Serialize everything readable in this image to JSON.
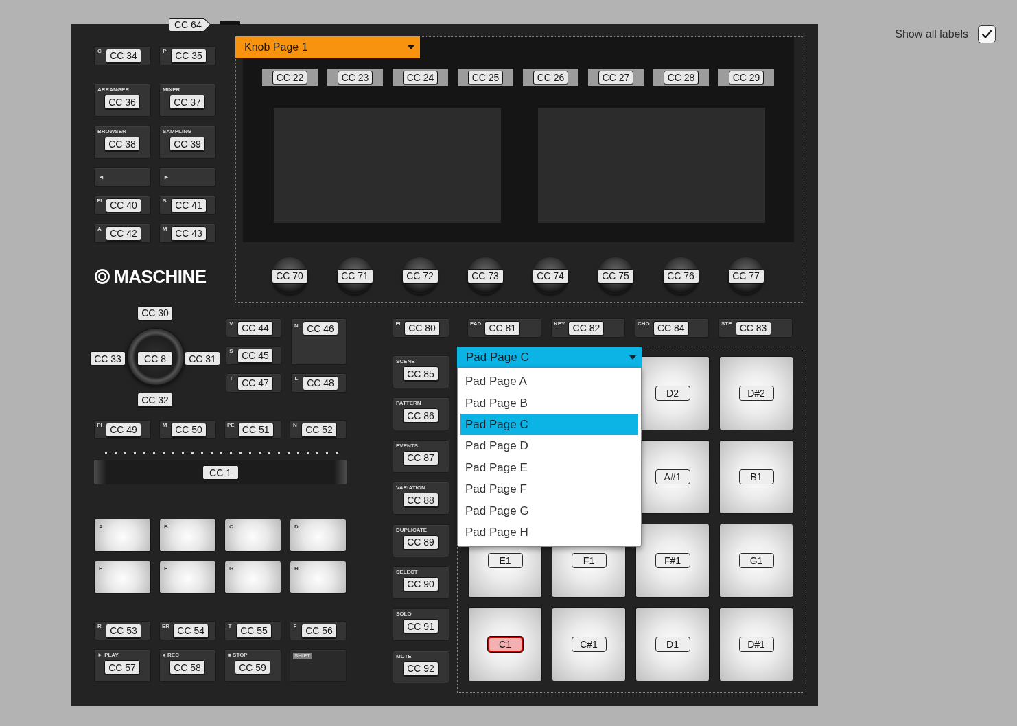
{
  "options": {
    "label": "Show all labels",
    "checked": true
  },
  "pedal": {
    "cc": "CC 64"
  },
  "view_buttons": [
    [
      {
        "kind": "short",
        "caption": "C",
        "cc": "CC 34"
      },
      {
        "kind": "short",
        "caption": "P",
        "cc": "CC 35"
      }
    ],
    [
      {
        "kind": "tall",
        "caption": "ARRANGER",
        "cc": "CC 36"
      },
      {
        "kind": "tall",
        "caption": "MIXER",
        "cc": "CC 37"
      }
    ],
    [
      {
        "kind": "tall",
        "caption": "BROWSER",
        "cc": "CC 38"
      },
      {
        "kind": "tall",
        "caption": "SAMPLING",
        "cc": "CC 39"
      }
    ],
    [
      {
        "kind": "short",
        "caption": "◄"
      },
      {
        "kind": "short",
        "caption": "►"
      }
    ],
    [
      {
        "kind": "short",
        "caption": "FI",
        "cc": "CC 40"
      },
      {
        "kind": "short",
        "caption": "S",
        "cc": "CC 41"
      }
    ],
    [
      {
        "kind": "short",
        "caption": "A",
        "cc": "CC 42"
      },
      {
        "kind": "short",
        "caption": "M",
        "cc": "CC 43"
      }
    ]
  ],
  "logo": {
    "text": "MASCHINE"
  },
  "knob_section": {
    "page_menu": {
      "value": "Knob Page 1"
    },
    "buttons": [
      "CC 22",
      "CC 23",
      "CC 24",
      "CC 25",
      "CC 26",
      "CC 27",
      "CC 28",
      "CC 29"
    ],
    "knobs": [
      "CC 70",
      "CC 71",
      "CC 72",
      "CC 73",
      "CC 74",
      "CC 75",
      "CC 76",
      "CC 77"
    ]
  },
  "encoder": {
    "top": "CC 30",
    "left": "CC 33",
    "center": "CC 8",
    "right": "CC 31",
    "bottom": "CC 32"
  },
  "encoder_buttons": [
    {
      "kind": "short",
      "caption": "V",
      "cc": "CC 44"
    },
    {
      "kind": "large",
      "caption": "N",
      "cc": "CC 46"
    },
    {
      "kind": "short",
      "caption": "S",
      "cc": "CC 45"
    },
    {
      "kind": "short",
      "caption": "T",
      "cc": "CC 47"
    },
    {
      "kind": "short",
      "caption": "L",
      "cc": "CC 48"
    }
  ],
  "performance_buttons": [
    {
      "kind": "short",
      "caption": "PI",
      "cc": "CC 49"
    },
    {
      "kind": "short",
      "caption": "M",
      "cc": "CC 50"
    },
    {
      "kind": "short",
      "caption": "PE",
      "cc": "CC 51"
    },
    {
      "kind": "short",
      "caption": "N",
      "cc": "CC 52"
    }
  ],
  "touch_strip": {
    "cc": "CC 1"
  },
  "group_pads": [
    {
      "label": "A"
    },
    {
      "label": "B"
    },
    {
      "label": "C"
    },
    {
      "label": "D"
    },
    {
      "label": "E"
    },
    {
      "label": "F"
    },
    {
      "label": "G"
    },
    {
      "label": "H"
    }
  ],
  "transport_buttons": [
    [
      {
        "kind": "short",
        "caption": "R",
        "cc": "CC 53"
      },
      {
        "kind": "short",
        "caption": "ER",
        "cc": "CC 54"
      },
      {
        "kind": "short",
        "caption": "T",
        "cc": "CC 55"
      },
      {
        "kind": "short",
        "caption": "F",
        "cc": "CC 56"
      }
    ],
    [
      {
        "kind": "tall",
        "caption": "► PLAY",
        "cc": "CC 57"
      },
      {
        "kind": "tall",
        "caption": "● REC",
        "cc": "CC 58"
      },
      {
        "kind": "tall",
        "caption": "■ STOP",
        "cc": "CC 59"
      },
      {
        "kind": "badge",
        "caption": "SHIFT"
      }
    ]
  ],
  "pad_mode_buttons": [
    {
      "kind": "short",
      "caption": "FI",
      "cc": "CC 80"
    },
    {
      "kind": "short",
      "caption": "PAD",
      "cc": "CC 81"
    },
    {
      "kind": "short",
      "caption": "KEY",
      "cc": "CC 82"
    },
    {
      "kind": "short",
      "caption": "CHO",
      "cc": "CC 84"
    },
    {
      "kind": "short",
      "caption": "STE",
      "cc": "CC 83"
    }
  ],
  "edit_buttons": [
    {
      "kind": "tall",
      "caption": "SCENE",
      "cc": "CC 85"
    },
    {
      "kind": "tall",
      "caption": "PATTERN",
      "cc": "CC 86"
    },
    {
      "kind": "tall",
      "caption": "EVENTS",
      "cc": "CC 87"
    },
    {
      "kind": "tall",
      "caption": "VARIATION",
      "cc": "CC 88"
    },
    {
      "kind": "tall",
      "caption": "DUPLICATE",
      "cc": "CC 89"
    },
    {
      "kind": "tall",
      "caption": "SELECT",
      "cc": "CC 90"
    },
    {
      "kind": "tall",
      "caption": "SOLO",
      "cc": "CC 91"
    },
    {
      "kind": "tall",
      "caption": "MUTE",
      "cc": "CC 92"
    }
  ],
  "pad_page_menu": {
    "value": "Pad Page C",
    "expanded": true,
    "options": [
      {
        "label": "Pad Page A",
        "selected": false
      },
      {
        "label": "Pad Page B",
        "selected": false
      },
      {
        "label": "Pad Page C",
        "selected": true
      },
      {
        "label": "Pad Page D",
        "selected": false
      },
      {
        "label": "Pad Page E",
        "selected": false
      },
      {
        "label": "Pad Page F",
        "selected": false
      },
      {
        "label": "Pad Page G",
        "selected": false
      },
      {
        "label": "Pad Page H",
        "selected": false
      }
    ]
  },
  "pad_rows": [
    {
      "pads": [
        {
          "label": "D2",
          "selected": false
        },
        {
          "label": "D#2",
          "selected": false
        }
      ]
    },
    {
      "pads": [
        {
          "label": "A#1",
          "selected": false
        },
        {
          "label": "B1",
          "selected": false
        }
      ]
    },
    {
      "pads": [
        {
          "label": "E1",
          "selected": false
        },
        {
          "label": "F1",
          "selected": false
        },
        {
          "label": "F#1",
          "selected": false
        },
        {
          "label": "G1",
          "selected": false
        }
      ]
    },
    {
      "pads": [
        {
          "label": "C1",
          "selected": true
        },
        {
          "label": "C#1",
          "selected": false
        },
        {
          "label": "D1",
          "selected": false
        },
        {
          "label": "D#1",
          "selected": false
        }
      ]
    }
  ]
}
